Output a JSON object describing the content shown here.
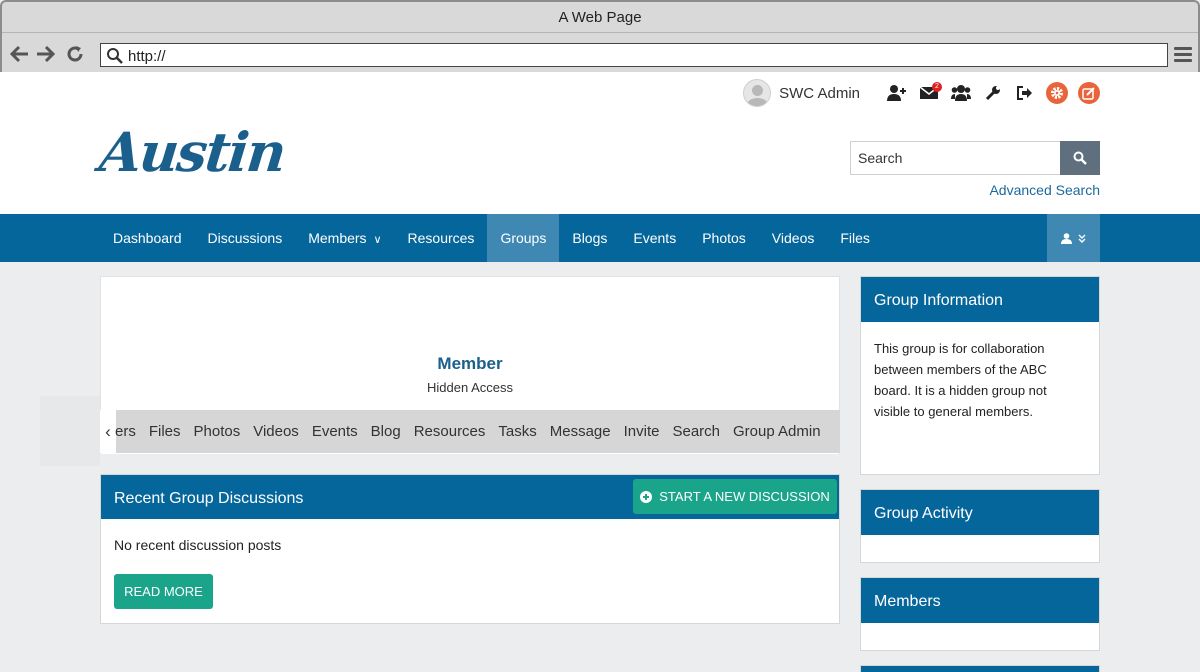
{
  "browser": {
    "window_title": "A Web Page",
    "url": "http://"
  },
  "user_bar": {
    "user_name": "SWC Admin",
    "messages_badge": "2"
  },
  "header": {
    "logo_text": "Austin",
    "search_placeholder": "Search",
    "search_value": "Search",
    "advanced_search": "Advanced Search"
  },
  "nav": {
    "items": [
      "Dashboard",
      "Discussions",
      "Members",
      "Resources",
      "Groups",
      "Blogs",
      "Events",
      "Photos",
      "Videos",
      "Files"
    ],
    "active": "Groups"
  },
  "group": {
    "role": "Member",
    "access": "Hidden Access",
    "tabs": [
      "ers",
      "Files",
      "Photos",
      "Videos",
      "Events",
      "Blog",
      "Resources",
      "Tasks",
      "Message",
      "Invite",
      "Search",
      "Group Admin"
    ]
  },
  "discussions": {
    "title": "Recent Group Discussions",
    "new_button": "START A NEW DISCUSSION",
    "empty_text": "No recent discussion posts",
    "read_more": "READ MORE"
  },
  "sidebar": {
    "info_title": "Group Information",
    "info_text": "This group is for collaboration between members of the ABC board. It is a hidden group not visible to general members.",
    "activity_title": "Group Activity",
    "members_title": "Members"
  },
  "colors": {
    "nav_blue": "#05669b",
    "active_blue": "#3f88b3",
    "green_button": "#1aa58a",
    "orange_icon": "#e8643a"
  }
}
